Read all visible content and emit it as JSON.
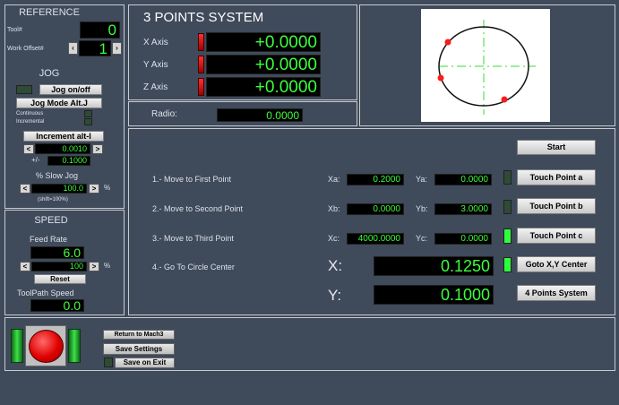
{
  "reference": {
    "title": "REFERENCE",
    "tool_label": "Tool#",
    "tool_value": "0",
    "work_offset_label": "Work Offset#",
    "work_offset_value": "1"
  },
  "jog": {
    "title": "JOG",
    "jog_toggle_label": "Jog on/off",
    "jog_mode_label": "Jog Mode Alt.J",
    "continuous_label": "Continuous",
    "incremental_label": "Incremental",
    "increment_button_label": "Increment alt-I",
    "increment_value": "0.0010",
    "plus_minus_label": "+/-",
    "plus_minus_value": "0.1000",
    "slow_jog_label": "% Slow Jog",
    "slow_jog_value": "100.0",
    "percent_label": "%",
    "shift_note": "(shift=100%)"
  },
  "speed": {
    "title": "SPEED",
    "feed_rate_label": "Feed Rate",
    "feed_rate_value": "6.0",
    "feed_override_value": "100",
    "percent_label": "%",
    "reset_label": "Reset",
    "toolpath_speed_label": "ToolPath Speed",
    "toolpath_speed_value": "0.0"
  },
  "axes": {
    "title": "3 POINTS SYSTEM",
    "x_label": "X Axis",
    "x_value": "+0.0000",
    "y_label": "Y Axis",
    "y_value": "+0.0000",
    "z_label": "Z Axis",
    "z_value": "+0.0000",
    "radio_label": "Radio:",
    "radio_value": "0.0000"
  },
  "steps": {
    "start_label": "Start",
    "step1_text": "1.- Move to First Point",
    "xa_label": "Xa:",
    "xa_value": "0.2000",
    "ya_label": "Ya:",
    "ya_value": "0.0000",
    "touch_a_label": "Touch Point a",
    "step2_text": "2.- Move to Second Point",
    "xb_label": "Xb:",
    "xb_value": "0.0000",
    "yb_label": "Yb:",
    "yb_value": "3.0000",
    "touch_b_label": "Touch Point b",
    "step3_text": "3.- Move to Third Point",
    "xc_label": "Xc:",
    "xc_value": "4000.0000",
    "yc_label": "Yc:",
    "yc_value": "0.0000",
    "touch_c_label": "Touch Point c",
    "step4_text": "4.- Go To Circle Center",
    "center_x_label": "X:",
    "center_x_value": "0.1250",
    "goto_center_label": "Goto X,Y Center",
    "center_y_label": "Y:",
    "center_y_value": "0.1000",
    "four_points_label": "4 Points System"
  },
  "bottom": {
    "return_label": "Return to Mach3",
    "save_settings_label": "Save Settings",
    "save_on_exit_label": "Save on Exit"
  },
  "colors": {
    "background": "#3f4a5a",
    "dro_text": "#3cff3c",
    "led_on": "#2dff3a",
    "estop_red": "#e00000"
  }
}
